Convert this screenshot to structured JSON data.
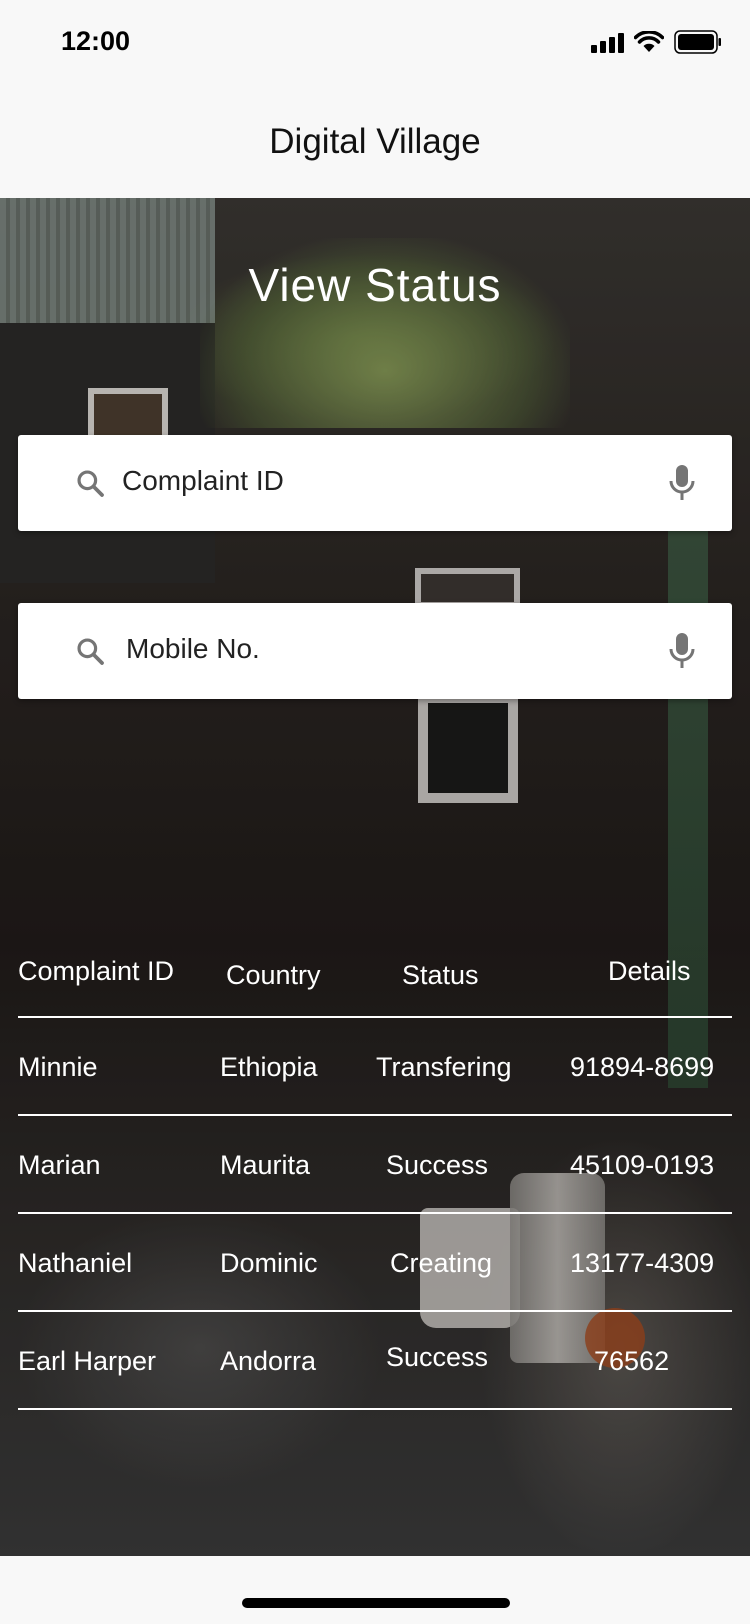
{
  "status_bar": {
    "time": "12:00"
  },
  "nav": {
    "title": "Digital Village"
  },
  "main": {
    "heading": "View Status",
    "search_complaint": {
      "placeholder": "Complaint ID"
    },
    "search_mobile": {
      "placeholder": "Mobile No."
    }
  },
  "table": {
    "headers": [
      "Complaint ID",
      "Country",
      "Status",
      "Details"
    ],
    "rows": [
      [
        "Minnie",
        "Ethiopia",
        "Transfering",
        "91894-8699"
      ],
      [
        "Marian",
        "Maurita",
        "Success",
        "45109-0193"
      ],
      [
        "Nathaniel",
        "Dominic",
        "Creating",
        "13177-4309"
      ],
      [
        "Earl Harper",
        "Andorra",
        "Success",
        "76562"
      ]
    ]
  },
  "icons": {
    "search": "search-icon",
    "mic": "microphone-icon",
    "signal": "signal-icon",
    "wifi": "wifi-icon",
    "battery": "battery-icon"
  },
  "colors": {
    "text_on_image": "#ffffff",
    "field_bg": "#ffffff",
    "icon_gray": "#757575"
  }
}
